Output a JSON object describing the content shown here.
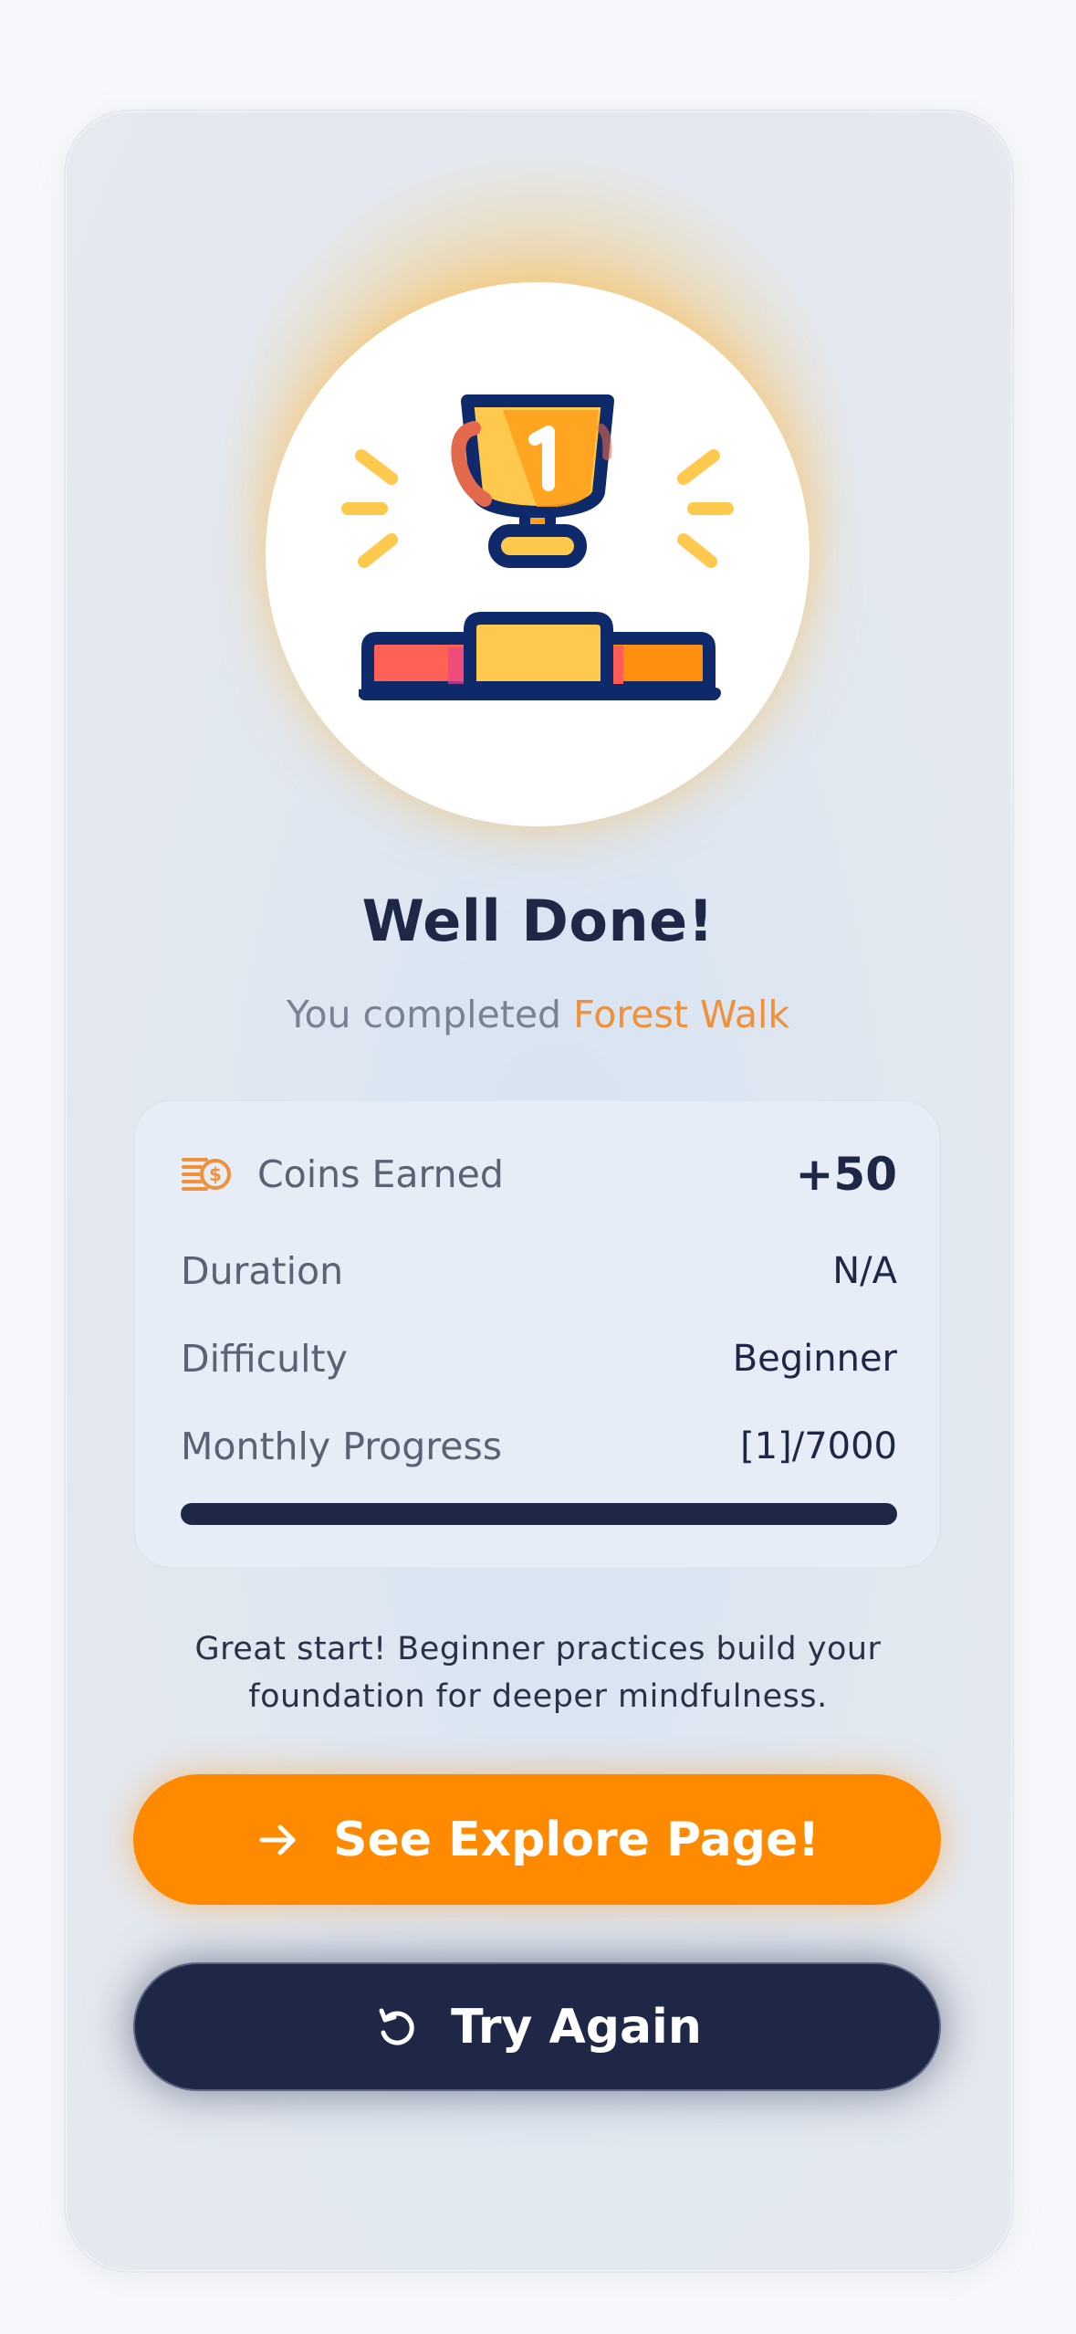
{
  "completion": {
    "title": "Well Done!",
    "subtitle_prefix": "You completed",
    "activity_name": "Forest Walk",
    "accent_color": "#f0913a"
  },
  "stats": {
    "coins_label": "Coins Earned",
    "coins_value": "+50",
    "coins_icon": "coins-icon",
    "duration_label": "Duration",
    "duration_value": "N/A",
    "difficulty_label": "Difficulty",
    "difficulty_value": "Beginner",
    "progress_label": "Monthly Progress",
    "progress_value": "[1]/7000"
  },
  "note": {
    "line1": "Great start! Beginner practices build your",
    "line2": "foundation for deeper mindfulness."
  },
  "buttons": {
    "explore_label": "See Explore Page!",
    "explore_icon": "arrow-right-icon",
    "explore_color": "#ff8a00",
    "retry_label": "Try Again",
    "retry_icon": "refresh-icon",
    "retry_color": "#1f2747"
  }
}
